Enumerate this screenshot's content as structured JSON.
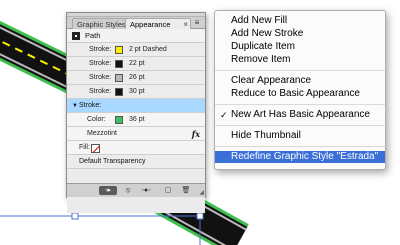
{
  "panel": {
    "tabs": [
      {
        "label": "Graphic Styles",
        "active": false
      },
      {
        "label": "Appearance",
        "active": true
      }
    ],
    "tab_close": "×",
    "menu_button": "≡",
    "path_label": "Path",
    "strokes": [
      {
        "label": "Stroke:",
        "color": "#ffee00",
        "value": "2 pt Dashed"
      },
      {
        "label": "Stroke:",
        "color": "#111111",
        "value": "22 pt"
      },
      {
        "label": "Stroke:",
        "color": "#b8b8b8",
        "value": "26 pt"
      },
      {
        "label": "Stroke:",
        "color": "#111111",
        "value": "30 pt"
      }
    ],
    "expanded_stroke": {
      "label": "Stroke:",
      "color_label": "Color:",
      "color": "#44bb66",
      "value": "36 pt",
      "effect": "Mezzotint",
      "fx": "fx"
    },
    "fill_label": "Fill:",
    "transparency": "Default Transparency",
    "bottom_buttons": [
      "◦▸",
      "⦸",
      "◦●◦",
      "▢",
      "🗑"
    ]
  },
  "menu": {
    "items": [
      {
        "label": "Add New Fill"
      },
      {
        "label": "Add New Stroke"
      },
      {
        "label": "Duplicate Item"
      },
      {
        "label": "Remove Item"
      },
      {
        "label": "Clear Appearance"
      },
      {
        "label": "Reduce to Basic Appearance"
      },
      {
        "label": "New Art Has Basic Appearance",
        "checked": true
      },
      {
        "label": "Hide Thumbnail"
      },
      {
        "label": "Redefine Graphic Style \"Estrada\"",
        "highlighted": true
      }
    ],
    "check_glyph": "✓"
  },
  "colors": {
    "menu_highlight": "#3a6fd8",
    "selected_layer": "#a8d8ff",
    "road_green": "#3fbf4f",
    "road_gray": "#b8b8b8",
    "road_dark": "#111111",
    "road_dash": "#ffee00",
    "selection_blue": "#4b6fd0"
  }
}
